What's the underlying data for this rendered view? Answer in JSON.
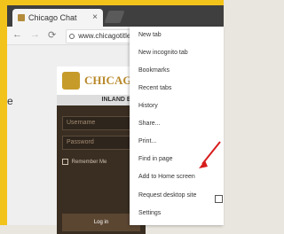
{
  "tab": {
    "title": "Chicago Chat"
  },
  "toolbar": {
    "url": "www.chicagotitlecha"
  },
  "page": {
    "site_title": "CHICAGO",
    "region": "INLAND EMPI",
    "username_placeholder": "Username",
    "password_placeholder": "Password",
    "remember": "Remember Me",
    "login_button": "Log in",
    "edge_letter": "e"
  },
  "menu": {
    "items": [
      "New tab",
      "New incognito tab",
      "Bookmarks",
      "Recent tabs",
      "History",
      "Share...",
      "Print...",
      "Find in page",
      "Add to Home screen",
      "Request desktop site",
      "Settings"
    ]
  }
}
